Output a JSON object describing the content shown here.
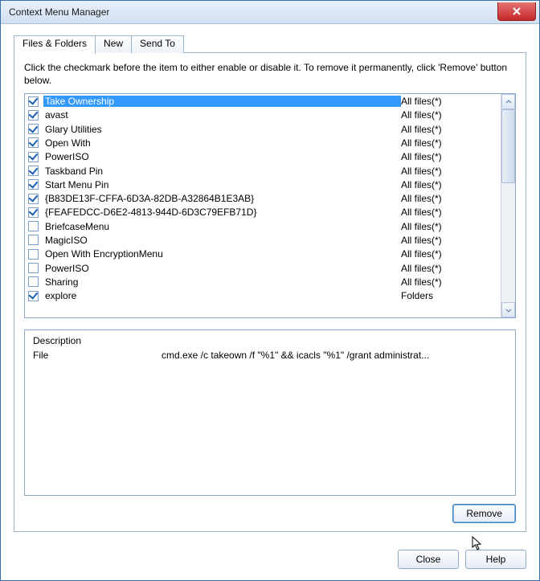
{
  "window": {
    "title": "Context Menu Manager"
  },
  "tabs": [
    {
      "label": "Files & Folders",
      "active": true
    },
    {
      "label": "New",
      "active": false
    },
    {
      "label": "Send To",
      "active": false
    }
  ],
  "instruction": "Click the checkmark before the item to either enable or disable it. To remove it permanently, click 'Remove' button below.",
  "items": [
    {
      "checked": true,
      "selected": true,
      "name": "Take Ownership",
      "type": "All files(*)"
    },
    {
      "checked": true,
      "selected": false,
      "name": "avast",
      "type": "All files(*)"
    },
    {
      "checked": true,
      "selected": false,
      "name": "Glary Utilities",
      "type": "All files(*)"
    },
    {
      "checked": true,
      "selected": false,
      "name": "Open With",
      "type": "All files(*)"
    },
    {
      "checked": true,
      "selected": false,
      "name": "PowerISO",
      "type": "All files(*)"
    },
    {
      "checked": true,
      "selected": false,
      "name": "Taskband Pin",
      "type": "All files(*)"
    },
    {
      "checked": true,
      "selected": false,
      "name": "Start Menu Pin",
      "type": "All files(*)"
    },
    {
      "checked": true,
      "selected": false,
      "name": "{B83DE13F-CFFA-6D3A-82DB-A32864B1E3AB}",
      "type": "All files(*)"
    },
    {
      "checked": true,
      "selected": false,
      "name": "{FEAFEDCC-D6E2-4813-944D-6D3C79EFB71D}",
      "type": "All files(*)"
    },
    {
      "checked": false,
      "selected": false,
      "name": "BriefcaseMenu",
      "type": "All files(*)"
    },
    {
      "checked": false,
      "selected": false,
      "name": "MagicISO",
      "type": "All files(*)"
    },
    {
      "checked": false,
      "selected": false,
      "name": "Open With EncryptionMenu",
      "type": "All files(*)"
    },
    {
      "checked": false,
      "selected": false,
      "name": "PowerISO",
      "type": "All files(*)"
    },
    {
      "checked": false,
      "selected": false,
      "name": "Sharing",
      "type": "All files(*)"
    },
    {
      "checked": true,
      "selected": false,
      "name": "explore",
      "type": "Folders"
    }
  ],
  "description": {
    "rows": [
      {
        "k": "Description",
        "v": ""
      },
      {
        "k": "File",
        "v": "cmd.exe /c takeown /f \"%1\" && icacls \"%1\" /grant administrat..."
      }
    ]
  },
  "buttons": {
    "remove": "Remove",
    "close": "Close",
    "help": "Help"
  }
}
